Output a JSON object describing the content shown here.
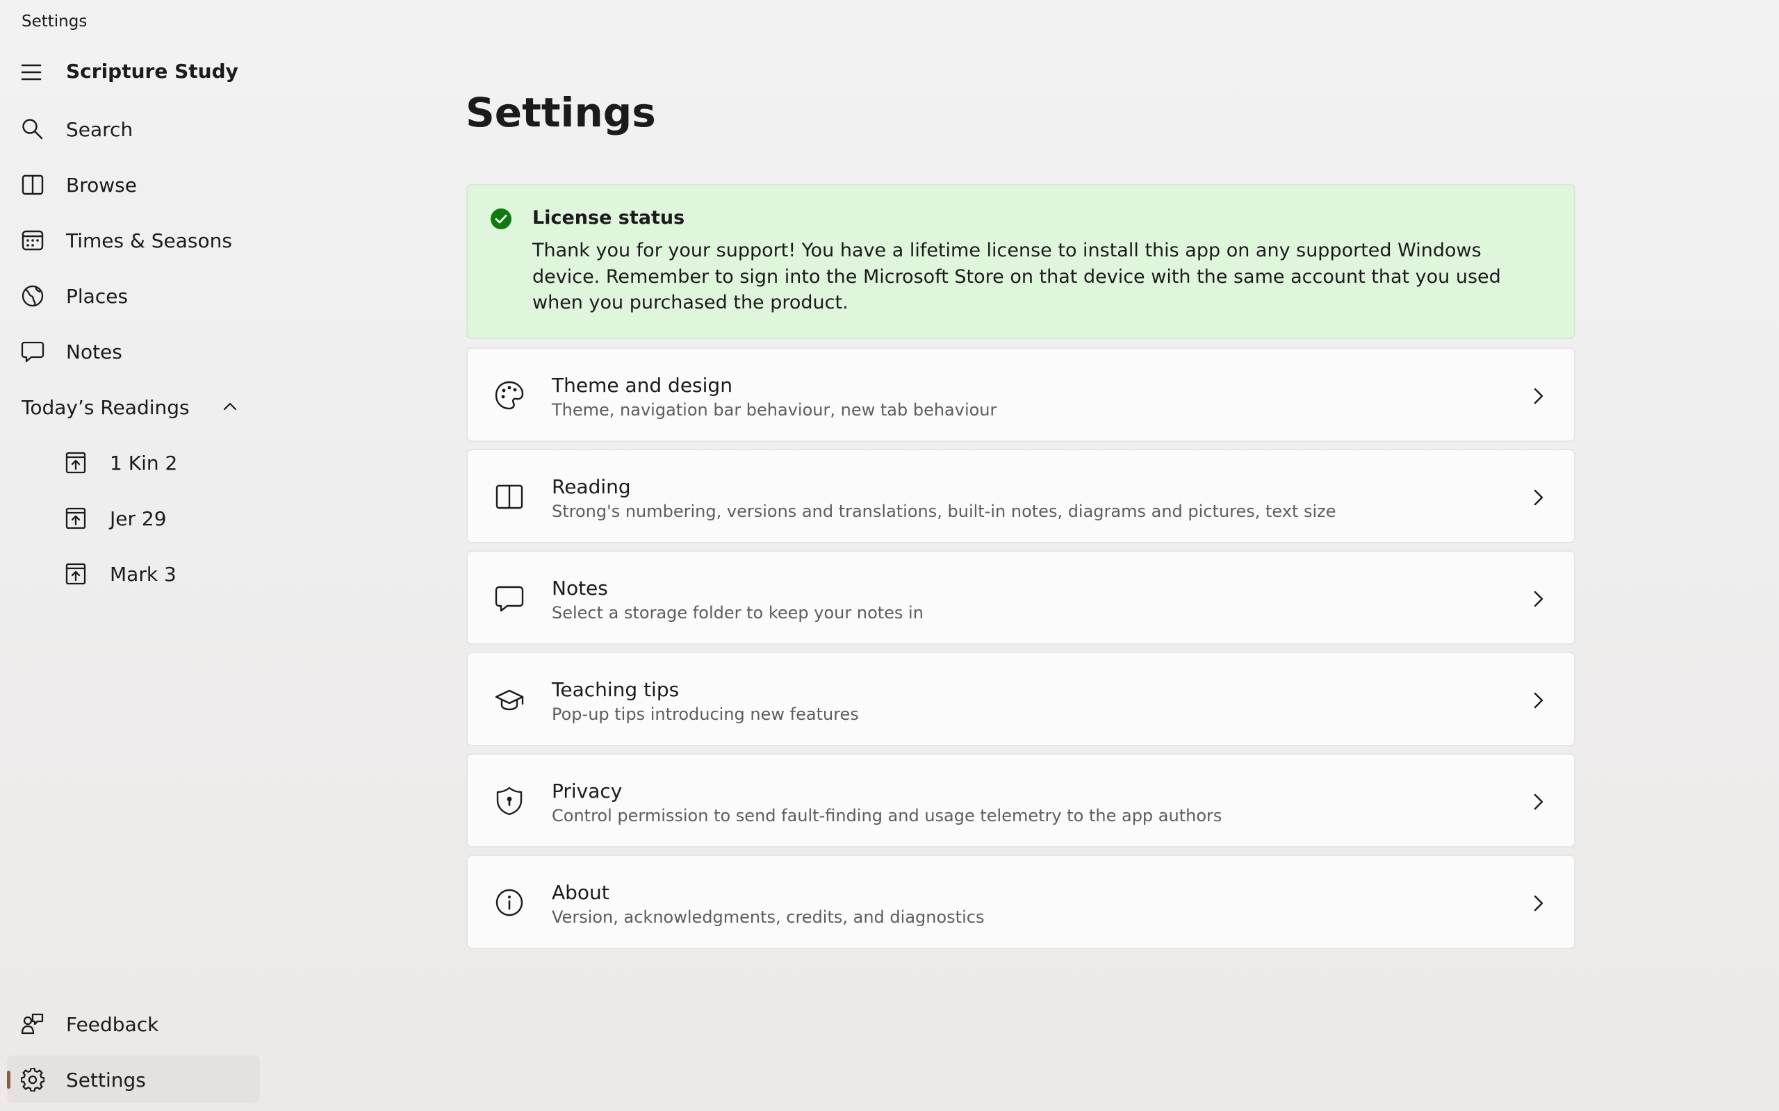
{
  "window": {
    "title": "Settings"
  },
  "nav": {
    "app_title": "Scripture Study",
    "items": [
      {
        "label": "Search",
        "icon": "search-icon"
      },
      {
        "label": "Browse",
        "icon": "book-icon"
      },
      {
        "label": "Times & Seasons",
        "icon": "calendar-icon"
      },
      {
        "label": "Places",
        "icon": "globe-icon"
      },
      {
        "label": "Notes",
        "icon": "speech-bubble-icon"
      }
    ],
    "readings_section": {
      "label": "Today’s Readings",
      "expanded": true,
      "items": [
        {
          "label": "1 Kin 2",
          "icon": "reading-icon"
        },
        {
          "label": "Jer 29",
          "icon": "reading-icon"
        },
        {
          "label": "Mark 3",
          "icon": "reading-icon"
        }
      ]
    },
    "footer": [
      {
        "label": "Feedback",
        "icon": "feedback-icon"
      },
      {
        "label": "Settings",
        "icon": "gear-icon",
        "selected": true
      }
    ]
  },
  "main": {
    "title": "Settings",
    "license": {
      "title": "License status",
      "text": "Thank you for your support!  You have a lifetime license to install this app on any supported Windows device. Remember to sign into the Microsoft Store on that device with the same account that you used when you purchased the product.",
      "status_color": "#0f7b0f",
      "background_color": "#dff6dd"
    },
    "cards": [
      {
        "title": "Theme and design",
        "description": "Theme, navigation bar behaviour, new tab behaviour",
        "icon": "palette-icon"
      },
      {
        "title": "Reading",
        "description": "Strong's numbering, versions and translations, built-in notes, diagrams and pictures, text size",
        "icon": "book-icon"
      },
      {
        "title": "Notes",
        "description": "Select a storage folder to keep your notes in",
        "icon": "speech-bubble-icon"
      },
      {
        "title": "Teaching tips",
        "description": "Pop-up tips introducing new features",
        "icon": "graduation-cap-icon"
      },
      {
        "title": "Privacy",
        "description": "Control permission to send fault-finding and usage telemetry to the app authors",
        "icon": "shield-lock-icon"
      },
      {
        "title": "About",
        "description": "Version, acknowledgments, credits, and diagnostics",
        "icon": "info-icon"
      }
    ]
  },
  "colors": {
    "accent": "#8a5a3c",
    "selected_background": "#e4e1df",
    "card_background": "#fbfbfb"
  }
}
